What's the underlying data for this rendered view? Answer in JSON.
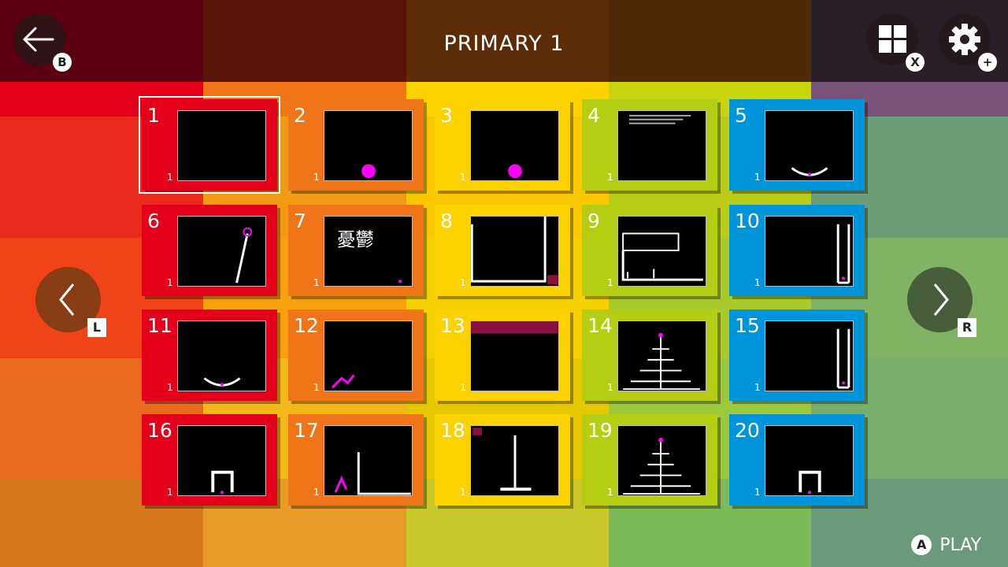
{
  "header": {
    "title": "PRIMARY 1",
    "back_badge": "B",
    "grid_badge": "X",
    "settings_badge": "+"
  },
  "nav": {
    "prev_label": "L",
    "next_label": "R"
  },
  "footer": {
    "play_badge": "A",
    "play_label": "PLAY"
  },
  "colors": {
    "red": "#e4001b",
    "orange": "#f07418",
    "yellow": "#fcd200",
    "green": "#b5cd12",
    "blue": "#0095da"
  },
  "levels": [
    {
      "num": "1",
      "count": "1",
      "color": "red",
      "thumb": "blank"
    },
    {
      "num": "2",
      "count": "1",
      "color": "orange",
      "thumb": "ball"
    },
    {
      "num": "3",
      "count": "1",
      "color": "yellow",
      "thumb": "ball"
    },
    {
      "num": "4",
      "count": "1",
      "color": "green",
      "thumb": "text"
    },
    {
      "num": "5",
      "count": "1",
      "color": "blue",
      "thumb": "cup"
    },
    {
      "num": "6",
      "count": "1",
      "color": "red",
      "thumb": "stick"
    },
    {
      "num": "7",
      "count": "1",
      "color": "orange",
      "thumb": "kanji"
    },
    {
      "num": "8",
      "count": "1",
      "color": "yellow",
      "thumb": "box"
    },
    {
      "num": "9",
      "count": "1",
      "color": "green",
      "thumb": "keyboard"
    },
    {
      "num": "10",
      "count": "1",
      "color": "blue",
      "thumb": "tube"
    },
    {
      "num": "11",
      "count": "1",
      "color": "red",
      "thumb": "cup"
    },
    {
      "num": "12",
      "count": "1",
      "color": "orange",
      "thumb": "creature"
    },
    {
      "num": "13",
      "count": "1",
      "color": "yellow",
      "thumb": "banner"
    },
    {
      "num": "14",
      "count": "1",
      "color": "green",
      "thumb": "pyramid"
    },
    {
      "num": "15",
      "count": "1",
      "color": "blue",
      "thumb": "tube"
    },
    {
      "num": "16",
      "count": "1",
      "color": "red",
      "thumb": "arch"
    },
    {
      "num": "17",
      "count": "1",
      "color": "orange",
      "thumb": "runner"
    },
    {
      "num": "18",
      "count": "1",
      "color": "yellow",
      "thumb": "tower"
    },
    {
      "num": "19",
      "count": "1",
      "color": "green",
      "thumb": "pyramid"
    },
    {
      "num": "20",
      "count": "1",
      "color": "blue",
      "thumb": "arch"
    }
  ]
}
